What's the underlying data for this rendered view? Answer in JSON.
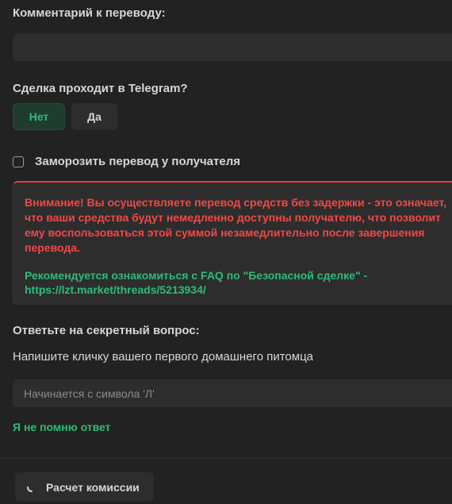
{
  "comment": {
    "label": "Комментарий к переводу:",
    "value": ""
  },
  "telegram_deal": {
    "label": "Сделка проходит в Telegram?",
    "no_label": "Нет",
    "yes_label": "Да",
    "selected": "Нет"
  },
  "freeze": {
    "label": "Заморозить перевод у получателя",
    "checked": false
  },
  "warning": {
    "text": "Внимание! Вы осуществляете перевод средств без задержки - это означает, что ваши средства будут немедленно доступны получателю, что позволит ему воспользоваться этой суммой незамедлительно после завершения перевода.",
    "faq": "Рекомендуется ознакомиться с FAQ по \"Безопасной сделке\" - https://lzt.market/threads/5213934/",
    "color": "#f04848",
    "faq_color": "#2fbb79"
  },
  "secret": {
    "label": "Ответьте на секретный вопрос:",
    "question": "Напишите кличку вашего первого домашнего питомца",
    "placeholder": "Начинается с символа 'Л'",
    "forgot": "Я не помню ответ"
  },
  "commission": {
    "label": "Расчет комиссии",
    "icon": "spinner-icon"
  },
  "colors": {
    "background": "#222222",
    "input": "#2d2d2d",
    "accent": "#2fbb79",
    "danger": "#e0413d"
  }
}
